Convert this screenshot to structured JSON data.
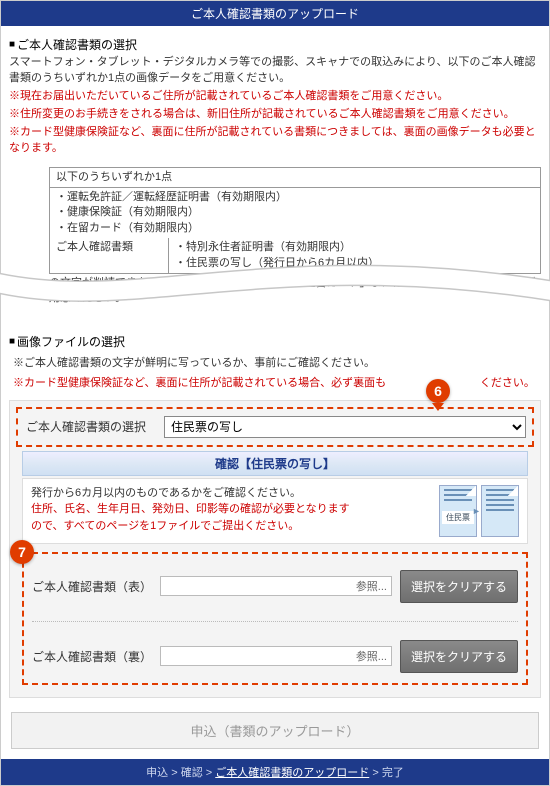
{
  "header": {
    "title": "ご本人確認書類のアップロード"
  },
  "section1": {
    "title": "ご本人確認書類の選択",
    "desc1": "スマートフォン・タブレット・デジタルカメラ等での撮影、スキャナでの取込みにより、以下のご本人確認書類のうちいずれか1点の画像データをご用意ください。",
    "warn1": "※現在お届出いただいているご住所が記載されているご本人確認書類をご用意ください。",
    "warn2": "※住所変更のお手続きをされる場合は、新旧住所が記載されているご本人確認書類をご用意ください。",
    "warn3": "※カード型健康保険証など、裏面に住所が記載されている書類につきましては、裏面の画像データも必要となります。"
  },
  "doc_table": {
    "head": "以下のうちいずれか1点",
    "items": [
      "・運転免許証／運転経歴証明書（有効期限内）",
      "・健康保険証（有効期限内）",
      "・在留カード（有効期限内）",
      "・特別永住者証明書（有効期限内）",
      "・住民票の写し（発行日から6カ月以内）"
    ],
    "side_label": "ご本人確認書類",
    "cut_note": "の文字が判読できない場合、再度お   さきましては「在留カード」または「特別永住者証明書」をご用意ください。"
  },
  "section2": {
    "title": "画像ファイルの選択",
    "line1": "※ご本人確認書類の文字が鮮明に写っているか、事前にご確認ください。",
    "line2_a": "※カード型健康保険証など、裏面に住所が記載されている場合、必ず裏面も",
    "line2_b": "ください。"
  },
  "select_box": {
    "label": "ご本人確認書類の選択",
    "value": "住民票の写し",
    "options": [
      "運転免許証／運転経歴証明書",
      "健康保険証",
      "在留カード",
      "特別永住者証明書",
      "住民票の写し"
    ]
  },
  "confirm": {
    "bar": "確認【住民票の写し】",
    "line1": "発行から6カ月以内のものであるかをご確認ください。",
    "line2": "住所、氏名、生年月日、発効日、印影等の確認が必要となります",
    "line3": "ので、すべてのページを1ファイルでご提出ください。",
    "sheet_label": "住民票"
  },
  "upload": {
    "row1_label": "ご本人確認書類（表）",
    "row2_label": "ご本人確認書類（裏）",
    "browse": "参照...",
    "clear": "選択をクリアする"
  },
  "submit": {
    "label": "申込（書類のアップロード）"
  },
  "footer": {
    "step1": "申込",
    "step2": "確認",
    "step3": "ご本人確認書類のアップロード",
    "step4": "完了",
    "sep": " > "
  },
  "callouts": {
    "six": "6",
    "seven": "7"
  }
}
